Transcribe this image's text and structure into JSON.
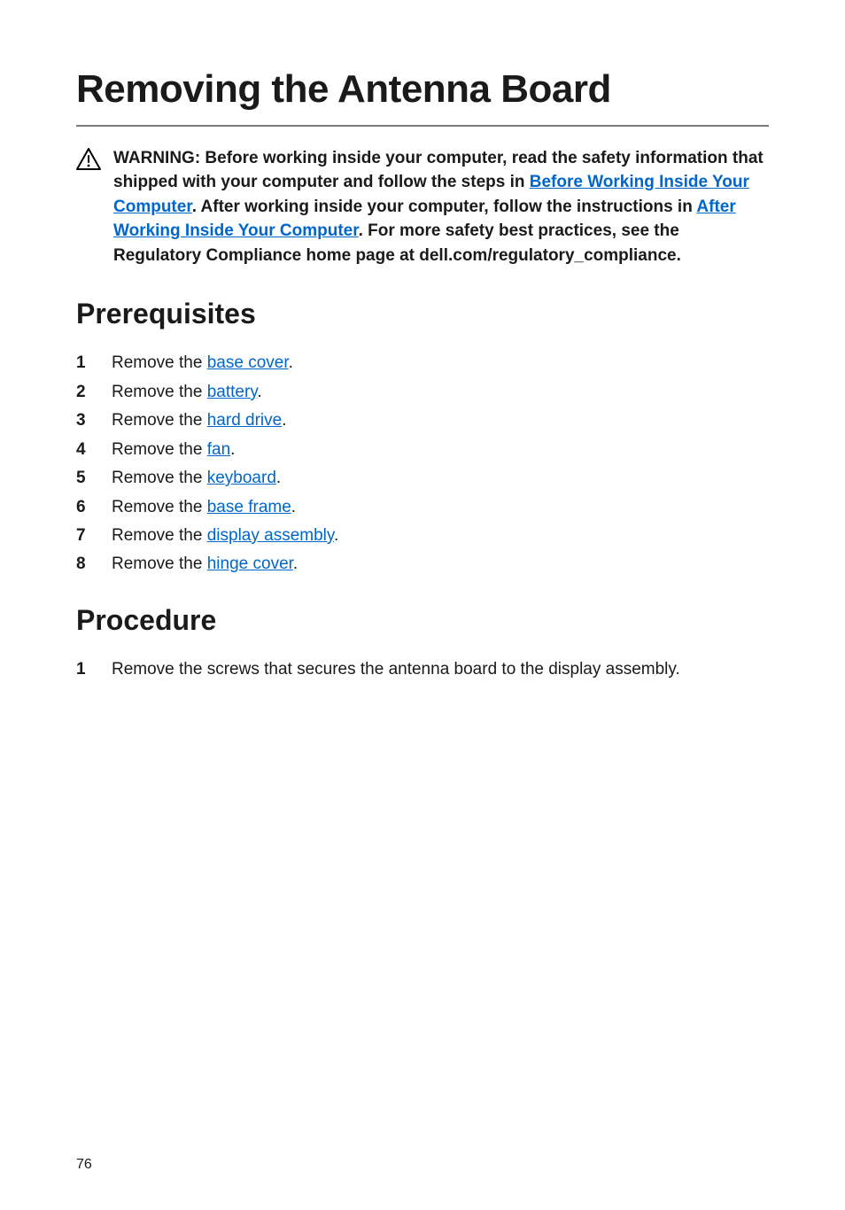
{
  "title": "Removing the Antenna Board",
  "warning": {
    "prefix": "WARNING: Before working inside your computer, read the safety information that shipped with your computer and follow the steps in ",
    "link1": "Before Working Inside Your Computer",
    "mid1": ". After working inside your computer, follow the instructions in ",
    "link2": "After Working Inside Your Computer",
    "suffix": ". For more safety best practices, see the Regulatory Compliance home page at dell.com/regulatory_compliance."
  },
  "sections": {
    "prereq_heading": "Prerequisites",
    "proc_heading": "Procedure"
  },
  "prereq": [
    {
      "pre": "Remove the ",
      "link": "base cover",
      "post": "."
    },
    {
      "pre": "Remove the ",
      "link": "battery",
      "post": "."
    },
    {
      "pre": "Remove the ",
      "link": "hard drive",
      "post": "."
    },
    {
      "pre": "Remove the ",
      "link": "fan",
      "post": "."
    },
    {
      "pre": "Remove the ",
      "link": "keyboard",
      "post": "."
    },
    {
      "pre": "Remove the ",
      "link": "base frame",
      "post": "."
    },
    {
      "pre": "Remove the ",
      "link": "display assembly",
      "post": "."
    },
    {
      "pre": "Remove the ",
      "link": "hinge cover",
      "post": "."
    }
  ],
  "procedure": [
    {
      "text": "Remove the screws that secures the antenna board to the display assembly."
    }
  ],
  "page_number": "76"
}
